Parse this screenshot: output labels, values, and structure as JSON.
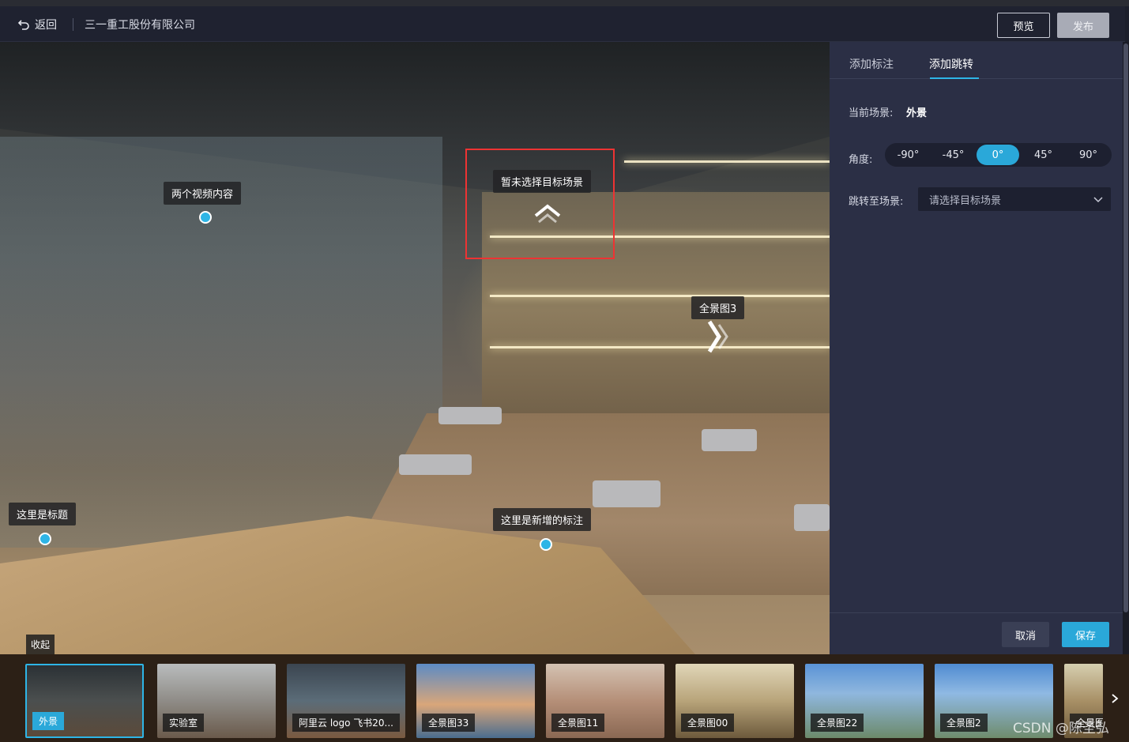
{
  "header": {
    "back_label": "返回",
    "company": "三一重工股份有限公司",
    "preview_label": "预览",
    "publish_label": "发布"
  },
  "viewer": {
    "hotspots": [
      {
        "label": "两个视频内容"
      },
      {
        "label": "暂未选择目标场景"
      },
      {
        "label": "全景图3"
      },
      {
        "label": "这里是标题"
      },
      {
        "label": "这里是新增的标注"
      }
    ],
    "collapse_label": "收起"
  },
  "panel": {
    "tabs": [
      {
        "label": "添加标注",
        "active": false
      },
      {
        "label": "添加跳转",
        "active": true
      }
    ],
    "current_scene_label": "当前场景:",
    "current_scene_value": "外景",
    "angle_label": "角度:",
    "angles": [
      "-90°",
      "-45°",
      "0°",
      "45°",
      "90°"
    ],
    "selected_angle": "0°",
    "jump_label": "跳转至场景:",
    "jump_placeholder": "请选择目标场景",
    "cancel_label": "取消",
    "save_label": "保存"
  },
  "scenes": [
    {
      "label": "外景",
      "active": true
    },
    {
      "label": "实验室",
      "active": false
    },
    {
      "label": "阿里云 logo 飞书20...",
      "active": false
    },
    {
      "label": "全景图33",
      "active": false
    },
    {
      "label": "全景图11",
      "active": false
    },
    {
      "label": "全景图00",
      "active": false
    },
    {
      "label": "全景图22",
      "active": false
    },
    {
      "label": "全景图2",
      "active": false
    },
    {
      "label": "全景图",
      "active": false
    }
  ],
  "watermark": "CSDN @陈圣弘",
  "colors": {
    "accent": "#2aa8d9",
    "panel": "#2b2f45",
    "highlight_box": "#ee3333"
  }
}
